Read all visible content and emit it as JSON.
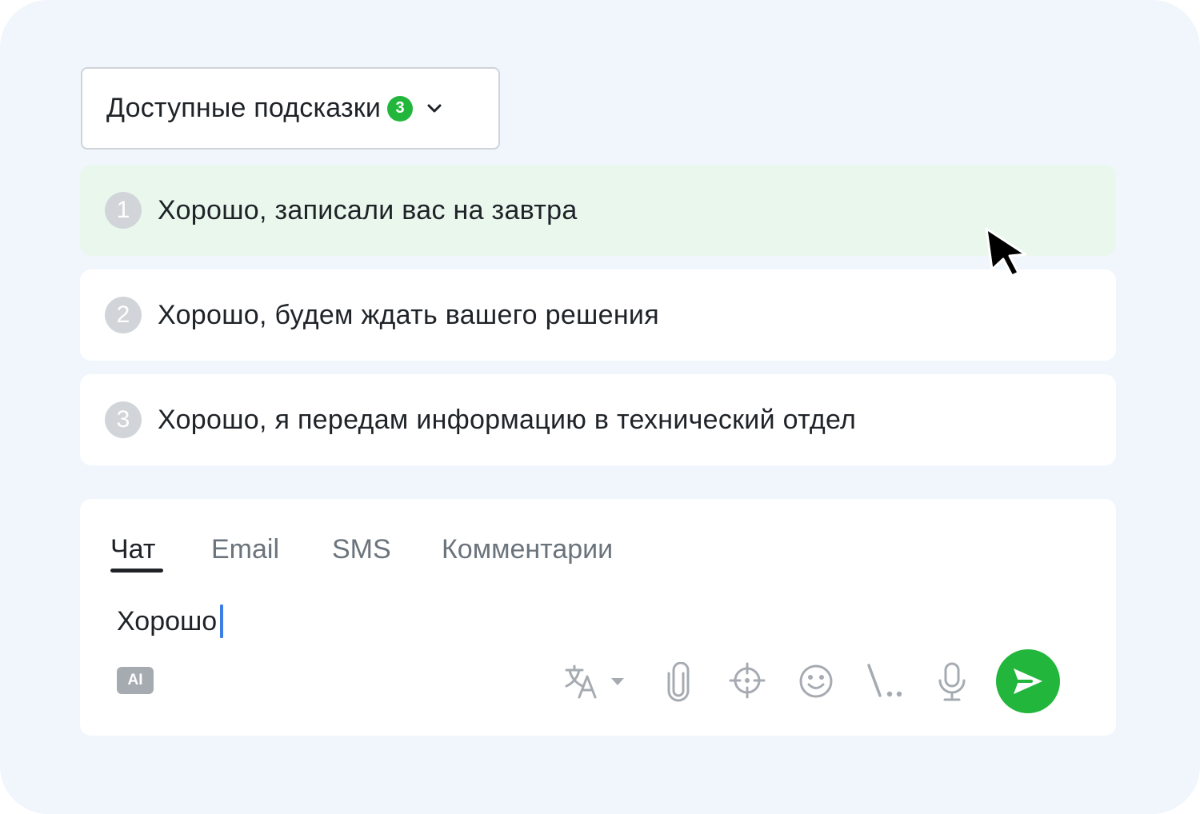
{
  "suggestions_panel": {
    "title": "Доступные подсказки",
    "count": "3",
    "items": [
      {
        "number": "1",
        "text": "Хорошо, записали вас на завтра"
      },
      {
        "number": "2",
        "text": "Хорошо, будем ждать вашего решения"
      },
      {
        "number": "3",
        "text": "Хорошо, я передам информацию в технический отдел"
      }
    ]
  },
  "composer": {
    "tabs": [
      {
        "label": "Чат"
      },
      {
        "label": "Email"
      },
      {
        "label": "SMS"
      },
      {
        "label": "Комментарии"
      }
    ],
    "active_tab": "Чат",
    "message_value": "Хорошо",
    "ai_label": "AI",
    "toolbar_icons": [
      "translate-icon",
      "paperclip-icon",
      "crosshair-icon",
      "smiley-icon",
      "slash-commands-icon",
      "microphone-icon",
      "send-icon"
    ]
  },
  "colors": {
    "background": "#f1f6fd",
    "accent_green": "#22b73c",
    "hover_green": "#e9f7ed",
    "caret_blue": "#3d7fe6"
  }
}
